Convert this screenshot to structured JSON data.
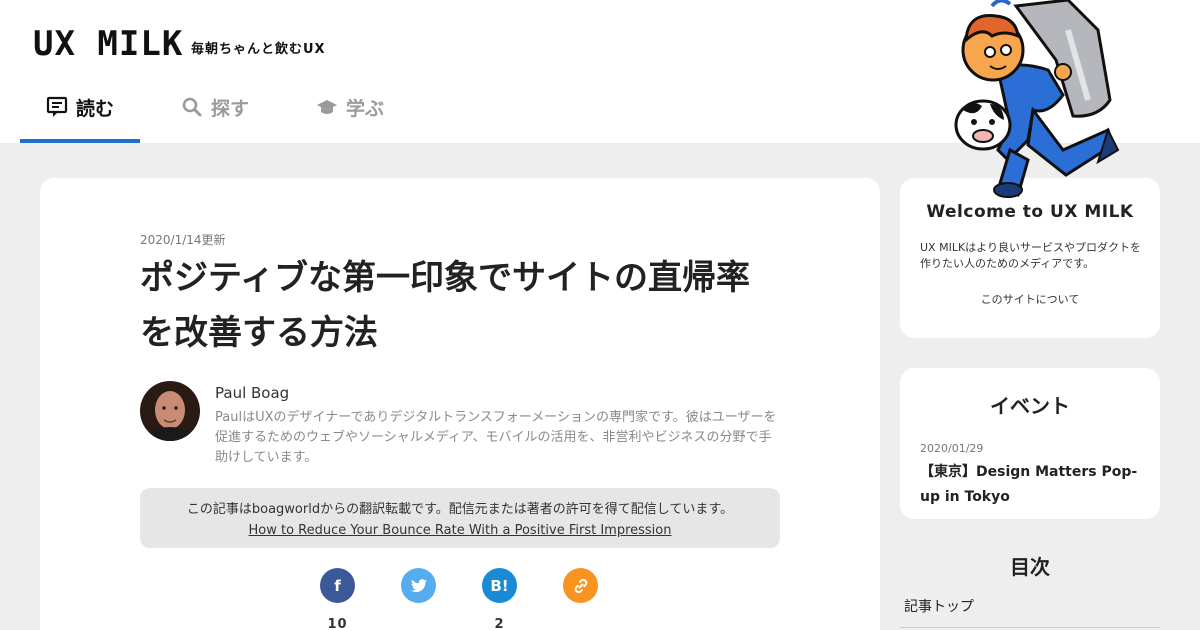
{
  "header": {
    "logo": "UX MILK",
    "tagline": "毎朝ちゃんと飲むUX",
    "nav": [
      {
        "label": "読む",
        "icon": "reading-icon",
        "active": true
      },
      {
        "label": "探す",
        "icon": "search-icon",
        "active": false
      },
      {
        "label": "学ぶ",
        "icon": "graduation-cap-icon",
        "active": false
      }
    ]
  },
  "article": {
    "date": "2020/1/14更新",
    "title": "ポジティブな第一印象でサイトの直帰率を改善する方法",
    "author": {
      "name": "Paul Boag",
      "bio": "PaulはUXのデザイナーでありデジタルトランスフォーメーションの専門家です。彼はユーザーを促進するためのウェブやソーシャルメディア、モバイルの活用を、非営利やビジネスの分野で手助けしています。"
    },
    "translation_note": "この記事はboagworldからの翻訳転載です。配信元または著者の許可を得て配信しています。",
    "original_link": "How to Reduce Your Bounce Rate With a Positive First Impression",
    "shares": [
      {
        "name": "facebook",
        "icon": "facebook-icon",
        "glyph": "f",
        "color": "#3b5998",
        "count": "10"
      },
      {
        "name": "twitter",
        "icon": "twitter-icon",
        "glyph": "",
        "color": "#55acee",
        "count": ""
      },
      {
        "name": "hatena",
        "icon": "hatena-bookmark-icon",
        "glyph": "B!",
        "color": "#1a8ad6",
        "count": "2"
      },
      {
        "name": "link",
        "icon": "link-icon",
        "glyph": "",
        "color": "#f7931e",
        "count": ""
      }
    ]
  },
  "sidebar": {
    "welcome": {
      "title": "Welcome to UX MILK",
      "text": "UX MILKはより良いサービスやプロダクトを作りたい人のためのメディアです。",
      "link": "このサイトについて"
    },
    "events": {
      "title": "イベント",
      "date": "2020/01/29",
      "name": "【東京】Design Matters Pop-up in Tokyo"
    },
    "toc": {
      "title": "目次",
      "items": [
        "記事トップ"
      ]
    }
  },
  "colors": {
    "accent": "#1f6fd1",
    "background": "#eeeeee",
    "facebook": "#3b5998",
    "twitter": "#55acee",
    "hatena": "#1a8ad6",
    "link": "#f7931e"
  }
}
